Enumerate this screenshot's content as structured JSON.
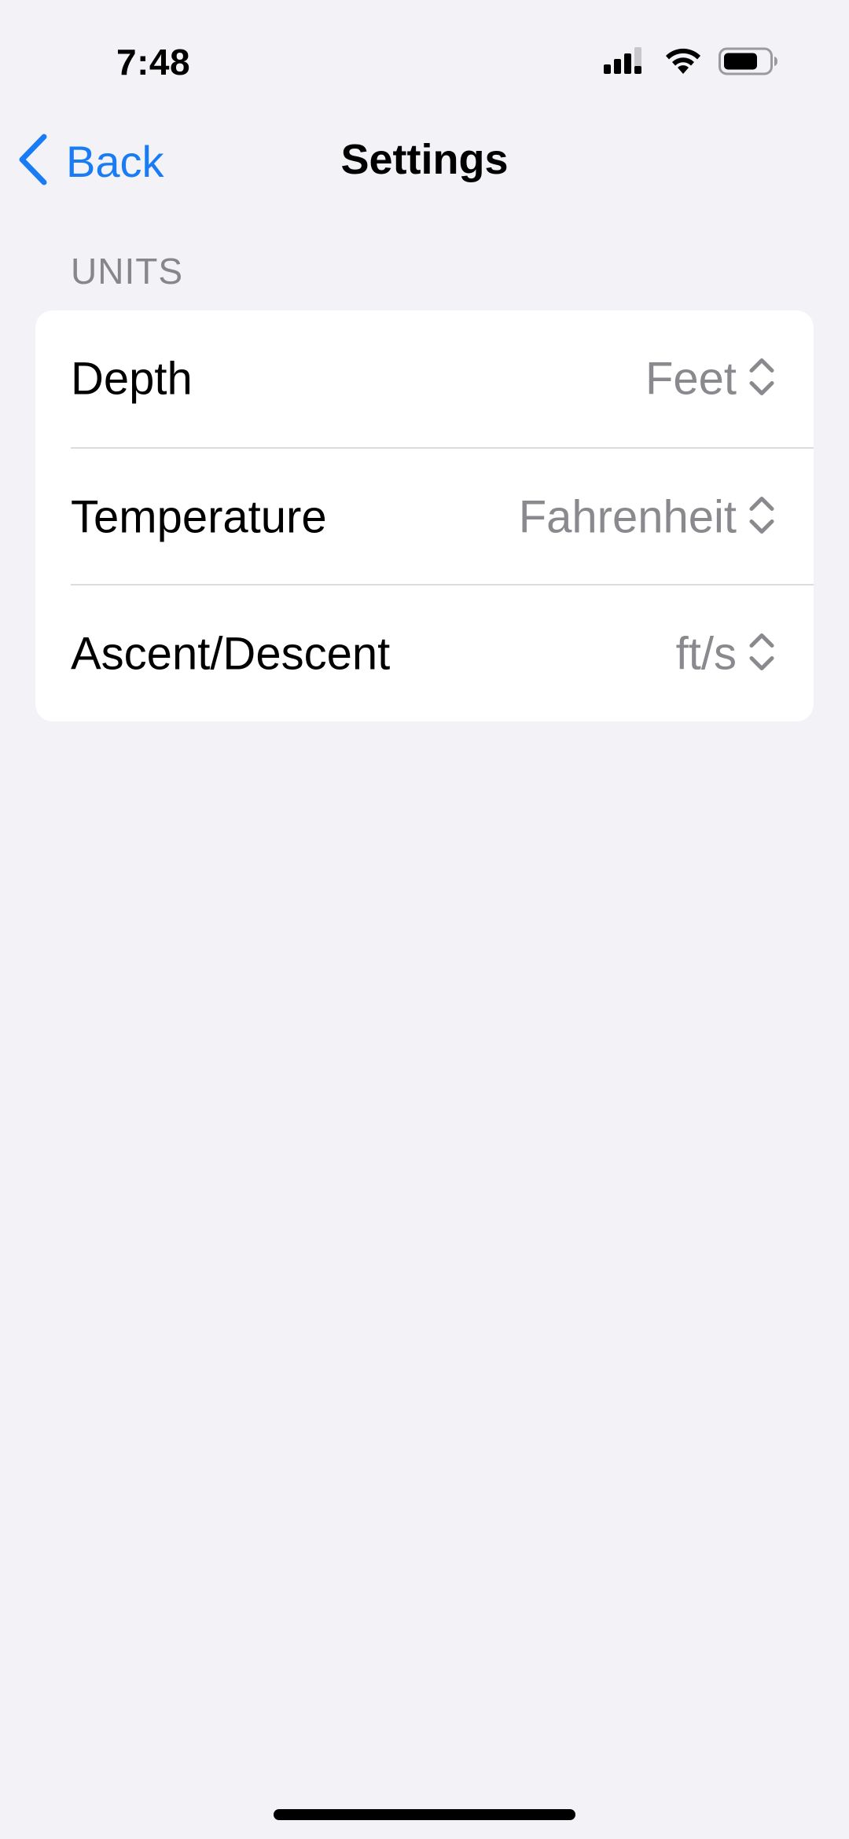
{
  "status_bar": {
    "time": "7:48",
    "icons": [
      "cellular-signal-icon",
      "wifi-icon",
      "battery-icon"
    ]
  },
  "nav": {
    "back_label": "Back",
    "title": "Settings",
    "accent_color": "#1a7cf5"
  },
  "units_section": {
    "header": "UNITS",
    "rows": [
      {
        "label": "Depth",
        "value": "Feet"
      },
      {
        "label": "Temperature",
        "value": "Fahrenheit"
      },
      {
        "label": "Ascent/Descent",
        "value": "ft/s"
      }
    ]
  }
}
